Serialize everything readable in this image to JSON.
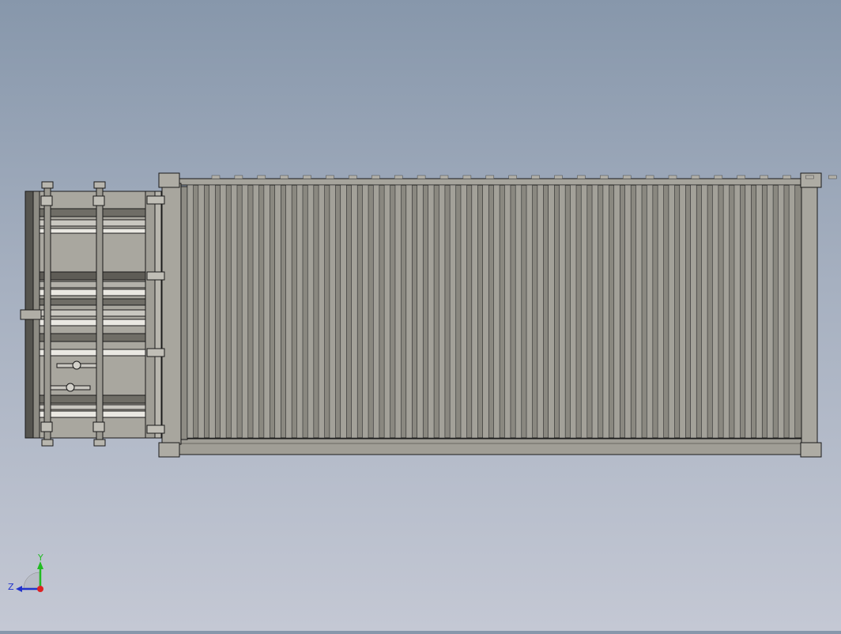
{
  "viewport": {
    "model": "shipping-container",
    "view": "top",
    "background_top": "#8797ab",
    "background_bottom": "#c4c8d4",
    "body_color": "#9b9990",
    "edge_color": "#1a1a1a",
    "corrugation_count": 56
  },
  "triad": {
    "y_label": "Y",
    "z_label": "Z",
    "y_color": "#22bb22",
    "z_color": "#2233cc",
    "x_color": "#dd2222"
  }
}
